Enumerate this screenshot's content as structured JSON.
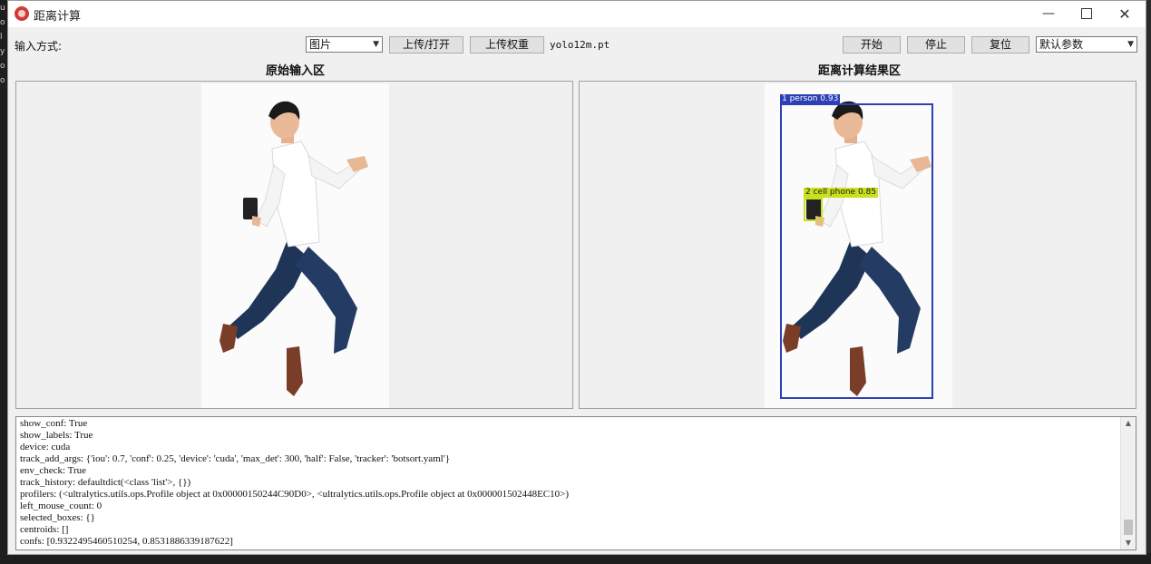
{
  "window": {
    "title": "距离计算"
  },
  "toolbar": {
    "input_mode_label": "输入方式:",
    "input_mode_selected": "图片",
    "upload_open_label": "上传/打开",
    "upload_weights_label": "上传权重",
    "weights_file": "yolo12m.pt",
    "start_label": "开始",
    "stop_label": "停止",
    "reset_label": "复位",
    "params_selected": "默认参数"
  },
  "panels": {
    "input_title": "原始输入区",
    "result_title": "距离计算结果区"
  },
  "detections": [
    {
      "id": 1,
      "class": "person",
      "label": "1 person 0.93",
      "confidence": 0.93,
      "color": "#2c3fb5"
    },
    {
      "id": 2,
      "class": "cell phone",
      "label": "2 cell phone 0.85",
      "confidence": 0.85,
      "color": "#c8e01e"
    }
  ],
  "log": {
    "lines": [
      "show_conf: True",
      "show_labels: True",
      "device: cuda",
      "track_add_args: {'iou': 0.7, 'conf': 0.25, 'device': 'cuda', 'max_det': 300, 'half': False, 'tracker': 'botsort.yaml'}",
      "env_check: True",
      "track_history: defaultdict(<class 'list'>, {})",
      "profilers: (<ultralytics.utils.ops.Profile object at 0x00000150244C90D0>, <ultralytics.utils.ops.Profile object at 0x000001502448EC10>)",
      "left_mouse_count: 0",
      "selected_boxes: {}",
      "centroids: []",
      "confs: [0.9322495460510254, 0.8531886339187622]"
    ]
  },
  "colors": {
    "window_bg": "#f0f0f0",
    "box_person": "#2c3fb5",
    "box_phone": "#c8e01e"
  }
}
